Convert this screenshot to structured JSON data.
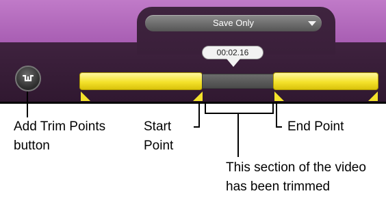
{
  "toolbar": {
    "save_dropdown_label": "Save Only",
    "save_dropdown_icon": "chevron-down-icon"
  },
  "timeline": {
    "current_time": "00:02.16",
    "trim_button_icon": "trim-points-icon",
    "kept_color": "#f4e22b",
    "trimmed_color": "#555555"
  },
  "annotations": {
    "add_trim_line1": "Add Trim Points",
    "add_trim_line2": "button",
    "start_line1": "Start",
    "start_line2": "Point",
    "end_point": "End Point",
    "trimmed_line1": "This section of the video",
    "trimmed_line2": "has been trimmed"
  }
}
